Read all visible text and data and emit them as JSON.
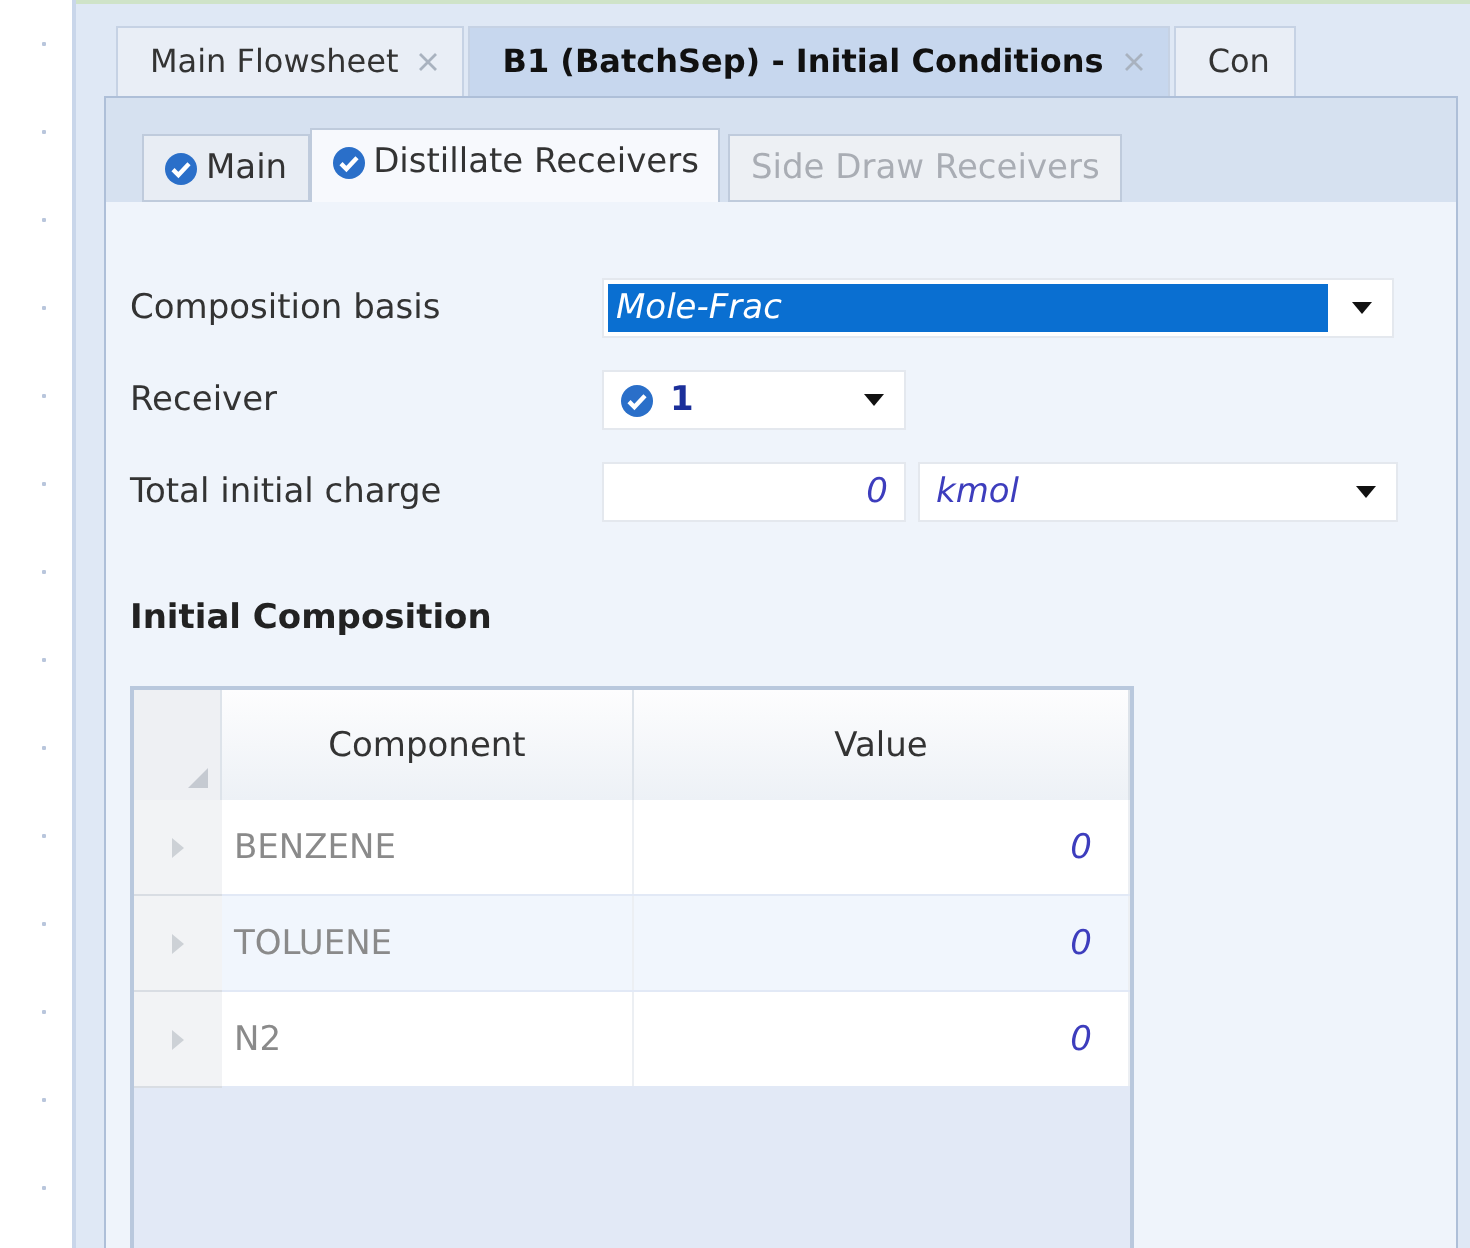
{
  "document_tabs": [
    {
      "label": "Main Flowsheet",
      "selected": false,
      "closable": true
    },
    {
      "label": "B1 (BatchSep) - Initial Conditions",
      "selected": true,
      "closable": true
    },
    {
      "label": "Con",
      "selected": false,
      "closable": false
    }
  ],
  "form_tabs": [
    {
      "label": "Main",
      "selected": false,
      "complete": true,
      "disabled": false
    },
    {
      "label": "Distillate Receivers",
      "selected": true,
      "complete": true,
      "disabled": false
    },
    {
      "label": "Side Draw Receivers",
      "selected": false,
      "complete": false,
      "disabled": true
    }
  ],
  "fields": {
    "composition_basis": {
      "label": "Composition basis",
      "value": "Mole-Frac",
      "highlighted": true
    },
    "receiver": {
      "label": "Receiver",
      "value": "1",
      "complete": true
    },
    "total_initial_charge": {
      "label": "Total initial charge",
      "value": "0",
      "unit": "kmol"
    }
  },
  "section_title": "Initial Composition",
  "table": {
    "columns": [
      "Component",
      "Value"
    ],
    "rows": [
      {
        "component": "BENZENE",
        "value": "0"
      },
      {
        "component": "TOLUENE",
        "value": "0"
      },
      {
        "component": "N2",
        "value": "0"
      }
    ]
  }
}
